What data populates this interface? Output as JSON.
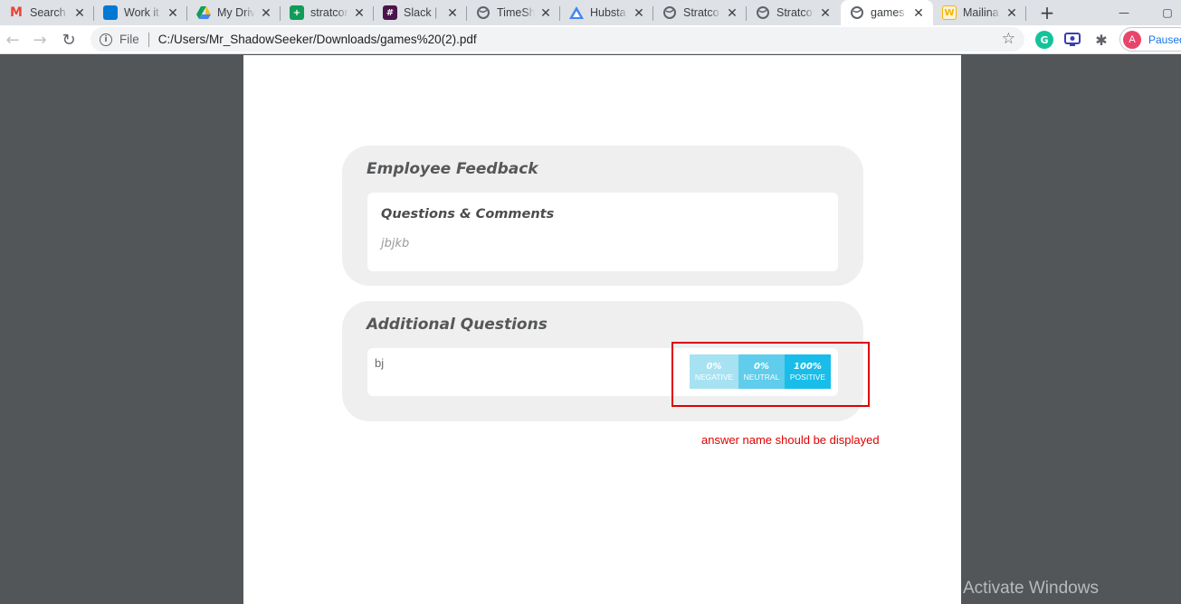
{
  "tabs": [
    {
      "title": "Search",
      "favicon": "gmail-icon",
      "color": "#ea4335",
      "glyph": "M"
    },
    {
      "title": "Work it",
      "favicon": "azure-devops-icon",
      "color": "#0078d4",
      "glyph": ""
    },
    {
      "title": "My Drive",
      "favicon": "google-drive-icon",
      "color": "#fbbc04",
      "glyph": ""
    },
    {
      "title": "stratcom",
      "favicon": "google-sheets-icon",
      "color": "#0f9d58",
      "glyph": "+"
    },
    {
      "title": "Slack |",
      "favicon": "slack-icon",
      "color": "#4a154b",
      "glyph": "#"
    },
    {
      "title": "TimeSh",
      "favicon": "globe-icon",
      "color": "#5f6368",
      "glyph": ""
    },
    {
      "title": "Hubsta",
      "favicon": "hubstaff-icon",
      "color": "#4285f4",
      "glyph": ""
    },
    {
      "title": "Stratco",
      "favicon": "globe-icon",
      "color": "#5f6368",
      "glyph": ""
    },
    {
      "title": "Stratco",
      "favicon": "globe-icon",
      "color": "#5f6368",
      "glyph": ""
    },
    {
      "title": "games",
      "favicon": "globe-icon",
      "color": "#5f6368",
      "glyph": ""
    },
    {
      "title": "Mailina",
      "favicon": "mailing-icon",
      "color": "#f4b400",
      "glyph": "W"
    }
  ],
  "address": {
    "security_label": "File",
    "url": "C:/Users/Mr_ShadowSeeker/Downloads/games%20(2).pdf"
  },
  "profile": {
    "initial": "A",
    "status": "Paused"
  },
  "feedback_card": {
    "title": "Employee Feedback",
    "section_title": "Questions & Comments",
    "answer": "jbjkb"
  },
  "additional_card": {
    "title": "Additional Questions",
    "question": "bj",
    "sentiment": [
      {
        "percent": "0%",
        "label": "NEGATIVE",
        "color": "#a7e2f2"
      },
      {
        "percent": "0%",
        "label": "NEUTRAL",
        "color": "#5fcdeb"
      },
      {
        "percent": "100%",
        "label": "POSITIVE",
        "color": "#18bde9"
      }
    ]
  },
  "annotation": {
    "note": "answer name should be displayed",
    "color": "#e00000"
  },
  "watermark": "Activate Windows"
}
